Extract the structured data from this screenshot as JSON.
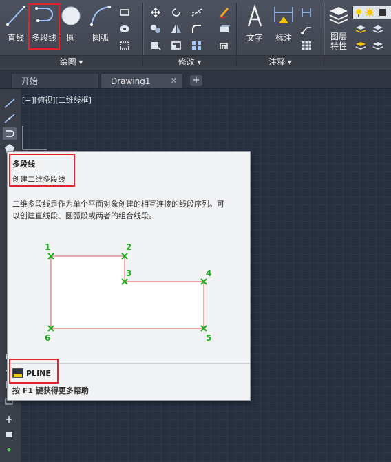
{
  "ribbon": {
    "draw_panel": {
      "title": "绘图 ▾",
      "buttons": [
        {
          "label": "直线",
          "icon": "line-icon"
        },
        {
          "label": "多段线",
          "icon": "polyline-icon"
        },
        {
          "label": "圆",
          "icon": "circle-icon"
        },
        {
          "label": "圆弧",
          "icon": "arc-icon"
        }
      ]
    },
    "modify_panel": {
      "title": "修改 ▾"
    },
    "annotate_panel": {
      "title": "注释 ▾",
      "buttons": [
        {
          "label": "文字",
          "icon": "text-icon"
        },
        {
          "label": "标注",
          "icon": "dimension-icon"
        }
      ]
    },
    "layers_panel": {
      "buttons": [
        {
          "label": "图层特性",
          "icon": "layer-properties-icon"
        }
      ]
    }
  },
  "tabs": [
    {
      "label": "开始"
    },
    {
      "label": "Drawing1"
    }
  ],
  "viewport_label": "[−][俯视][二维线框]",
  "tooltip": {
    "title": "多段线",
    "subtitle": "创建二维多段线",
    "description_line1": "二维多段线是作为单个平面对象创建的相互连接的线段序列。可",
    "description_line2": "以创建直线段、圆弧段或两者的组合线段。",
    "vertices": [
      "1",
      "2",
      "3",
      "4",
      "5",
      "6"
    ],
    "command": "PLINE",
    "help": "按 F1 键获得更多帮助"
  },
  "colors": {
    "highlight": "#e5212a",
    "vertex_marker": "#1fae1f",
    "polyline_stroke": "#e05a5a"
  }
}
